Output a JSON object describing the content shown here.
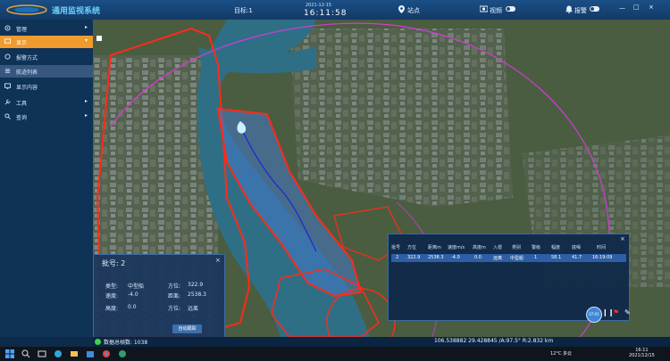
{
  "header": {
    "app_title": "通用监视系统",
    "target_count": "目标:1",
    "date": "2021-12-15",
    "clock": "16:11:58",
    "station_label": "站点",
    "video_label": "视频",
    "alarm_label": "报警",
    "video_toggle_on": false,
    "alarm_toggle_on": false
  },
  "sidebar": {
    "items": [
      {
        "label": "管理",
        "icon": "gear-icon"
      },
      {
        "label": "显示",
        "icon": "display-icon",
        "active": true
      },
      {
        "label": "报警方式",
        "icon": "alarm-icon"
      },
      {
        "label": "航迹列表",
        "icon": "list-icon"
      },
      {
        "label": "显示内容",
        "icon": "monitor-icon"
      },
      {
        "label": "工具",
        "icon": "wrench-icon"
      },
      {
        "label": "查询",
        "icon": "search-icon"
      }
    ]
  },
  "info_panel": {
    "title": "批号: 2",
    "close": "×",
    "type_label": "类型:",
    "type_value": "中型船",
    "bearing_label": "方位:",
    "bearing_value": "322.9",
    "speed_label": "速度:",
    "speed_value": "-4.0",
    "distance_label": "距离:",
    "distance_value": "2538.3",
    "height_label": "高度:",
    "height_value": "0.0",
    "direction_label": "方位:",
    "direction_value": "远离",
    "track_button": "自动跟踪"
  },
  "track_table": {
    "close": "×",
    "headers": [
      "批号",
      "方位",
      "距离m",
      "速度m/s",
      "高度m",
      "入侵",
      "类别",
      "警级",
      "幅度",
      "底噪",
      "时间"
    ],
    "rows": [
      [
        "2",
        "322.9",
        "2538.3",
        "-4.0",
        "0.0",
        "远离",
        "中型船",
        "1",
        "58.1",
        "41.7",
        "16:19:09"
      ]
    ]
  },
  "statusbar": {
    "count_text": "数据总帧数: 1038",
    "coords_text": "106.538882  29.428845 /A:97.5° R:2.832 km"
  },
  "playback": {
    "label": "07:01"
  },
  "taskbar": {
    "temperature": "12°C 多云",
    "time": "16:11",
    "date": "2021/12/15"
  },
  "colors": {
    "accent": "#ef9b2e",
    "title_blue": "#6fd1ff",
    "zone_red": "#ff2a1a",
    "range_ring": "#d43bd8",
    "track_blue": "#1e2fd0",
    "river": "#2f6f86"
  }
}
